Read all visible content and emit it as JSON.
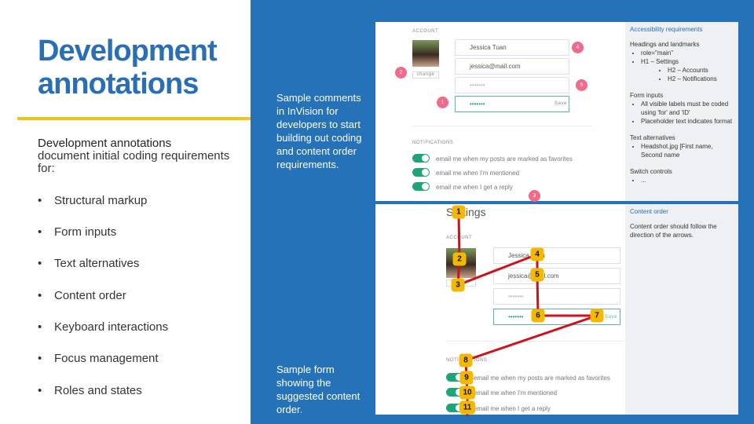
{
  "title": "Development annotations",
  "intro": {
    "bold": "Development annotations",
    "rest": "document initial coding requirements for:"
  },
  "bullets": [
    "Structural markup",
    "Form inputs",
    "Text alternatives",
    "Content order",
    "Keyboard interactions",
    "Focus management",
    "Roles and states"
  ],
  "captions": {
    "top": "Sample comments in InVision for developers to start building out coding and content order requirements.",
    "bottom": "Sample form showing the suggested content order."
  },
  "mockup": {
    "account": "ACCOUNT",
    "settings": "Settings",
    "name": "Jessica Tuan",
    "email": "jessica@mail.com",
    "password": "•••••••",
    "change": "change",
    "save": "Save",
    "notifications": "NOTIFICATIONS",
    "toggles": [
      "email me when my posts are marked as favorites",
      "email me when I'm mentioned",
      "email me when I get a reply"
    ]
  },
  "top_markers": [
    "4",
    "2",
    "5",
    "1",
    "3"
  ],
  "order_markers": [
    "1",
    "2",
    "3",
    "4",
    "5",
    "6",
    "7",
    "8",
    "9",
    "10",
    "11"
  ],
  "accessibility": {
    "title": "Accessibility requirements",
    "headings": "Headings and landmarks",
    "h_items": [
      "role=\"main\"",
      "H1 – Settings"
    ],
    "h_sub": [
      "H2 – Accounts",
      "H2 – Notifications"
    ],
    "form": "Form inputs",
    "form_items": [
      "All visible labels must be coded using 'for' and 'ID'",
      "Placeholder text indicates format"
    ],
    "text_alt": "Text alternatives",
    "text_alt_items": [
      "Headshot.jpg [First name, Second name"
    ],
    "switch": "Switch controls",
    "switch_items": [
      "..."
    ]
  },
  "content_order": {
    "title": "Content order",
    "text": "Content order should follow the direction of the arrows."
  },
  "colors": {
    "blue": "#2672b9",
    "accent": "#f0c419",
    "marker": "#f5b800",
    "line": "#d0101a",
    "toggle": "#1fa37a"
  }
}
